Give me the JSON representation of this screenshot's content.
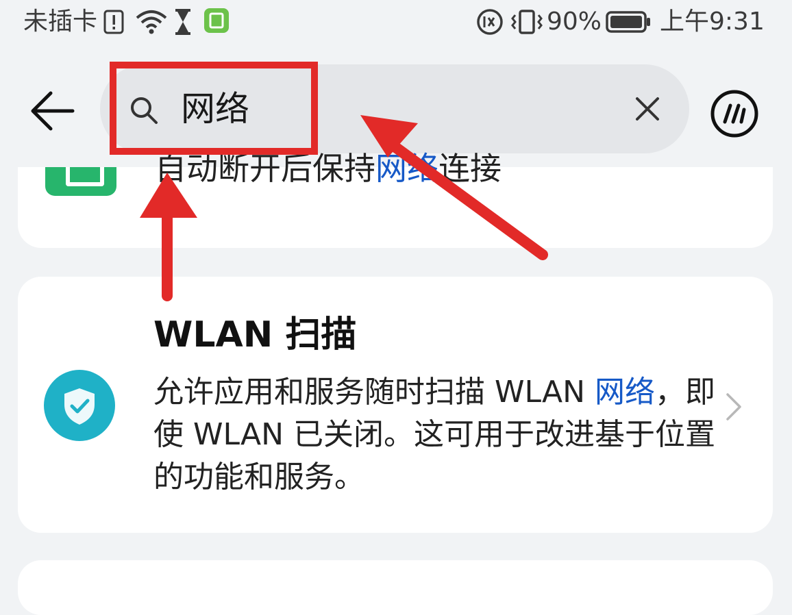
{
  "status_bar": {
    "carrier": "未插卡",
    "battery_percent": "90%",
    "time": "上午9:31",
    "icons": [
      "sim-alert-icon",
      "wifi-icon",
      "hourglass-icon",
      "charging-app-icon",
      "hd-voice-icon",
      "vibrate-icon",
      "battery-icon"
    ]
  },
  "header": {
    "back_icon": "back-arrow-icon",
    "search_icon": "search-icon",
    "search_value": "网络",
    "clear_icon": "close-icon",
    "assistant_icon": "assistant-icon"
  },
  "results": [
    {
      "clipped_text_before": "自动断开后保持",
      "clipped_text_highlight": "网络",
      "clipped_text_after": "连接",
      "icon": "green-app-icon"
    },
    {
      "title": "WLAN 扫描",
      "desc_before": "允许应用和服务随时扫描 WLAN ",
      "desc_highlight": "网络",
      "desc_after": "，即使 WLAN 已关闭。这可用于改进基于位置的功能和服务。",
      "icon": "shield-check-icon",
      "chevron_icon": "chevron-right-icon"
    }
  ],
  "colors": {
    "highlight": "#1659c7",
    "annotation": "#e22a28",
    "card": "#ffffff",
    "background": "#f1f3f5",
    "shield": "#1fb1c7"
  }
}
